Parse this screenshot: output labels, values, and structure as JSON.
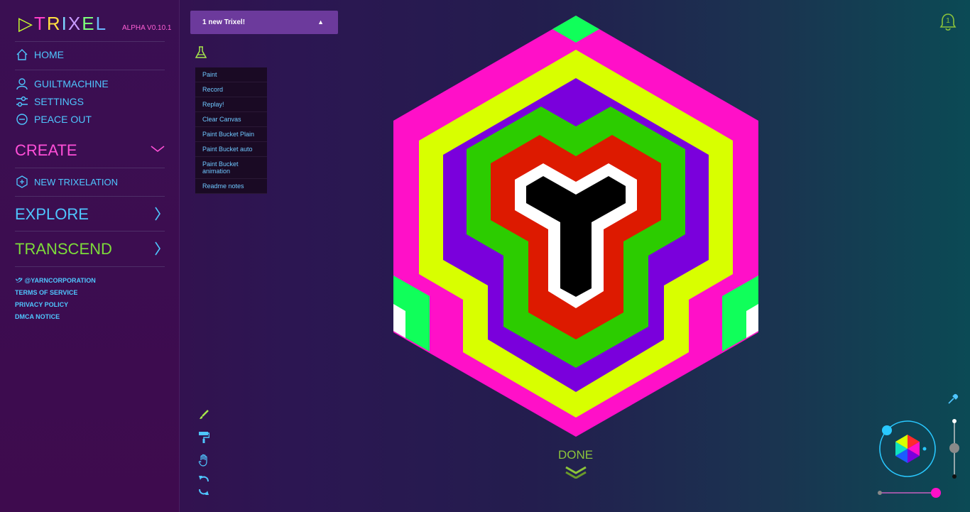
{
  "brand": {
    "logo_parts": [
      "T",
      "R",
      "I",
      "X",
      "E",
      "L"
    ],
    "version": "ALPHA V0.10.1"
  },
  "nav": {
    "home": "HOME",
    "user": "GUILTMACHINE",
    "settings": "SETTINGS",
    "logout": "PEACE OUT",
    "create": "CREATE",
    "new_trixelation": "NEW TRIXELATION",
    "explore": "EXPLORE",
    "transcend": "TRANSCEND"
  },
  "footer": {
    "twitter": "@YARNCORPORATION",
    "terms": "TERMS OF SERVICE",
    "privacy": "PRIVACY POLICY",
    "dmca": "DMCA NOTICE"
  },
  "notification": {
    "text": "1 new Trixel!"
  },
  "lab_menu": {
    "items": [
      "Paint",
      "Record",
      "Replay!",
      "Clear Canvas",
      "Paint Bucket Plain",
      "Paint Bucket auto",
      "Paint Bucket animation",
      "Readme notes"
    ]
  },
  "tools": [
    "paintbrush-icon",
    "paint-roller-icon",
    "hand-icon",
    "undo-icon",
    "redo-icon"
  ],
  "canvas": {
    "done_label": "DONE"
  },
  "bell": {
    "count": "1"
  },
  "colors": {
    "magenta": "#ff10c8",
    "lime": "#d8ff00",
    "purple": "#7a00dc",
    "green": "#2ccc00",
    "red": "#dd1a00",
    "white": "#ffffff",
    "black": "#000000",
    "bright_green": "#10ff5a",
    "accent_blue": "#4fc6ff"
  }
}
